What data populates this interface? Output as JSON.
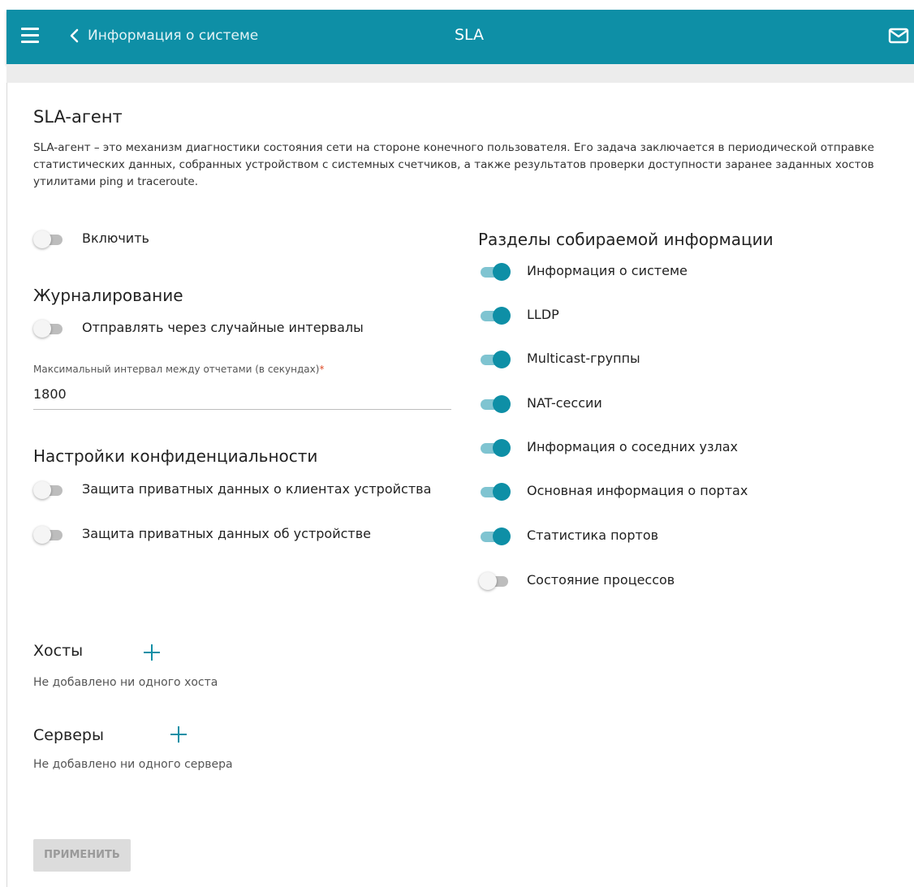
{
  "header": {
    "back_label": "Информация о системе",
    "title": "SLA",
    "accent_color": "#0e8fa6",
    "icons": [
      "menu-icon",
      "chevron-left-icon",
      "mail-icon"
    ]
  },
  "sla_agent": {
    "title": "SLA-агент",
    "description": "SLA-агент – это механизм диагностики состояния сети на стороне конечного пользователя. Его задача заключается в периодической отправке статистических данных, собранных устройством с системных счетчиков, а также результатов проверки доступности заранее заданных хостов утилитами ping и traceroute.",
    "enable": {
      "label": "Включить",
      "on": false
    }
  },
  "logging": {
    "title": "Журналирование",
    "random_intervals": {
      "label": "Отправлять через случайные интервалы",
      "on": false
    },
    "max_interval": {
      "label": "Максимальный интервал между отчетами (в секундах)",
      "required_mark": "*",
      "value": "1800"
    }
  },
  "privacy": {
    "title": "Настройки конфиденциальности",
    "toggles": [
      {
        "label": "Защита приватных данных о клиентах устройства",
        "on": false
      },
      {
        "label": "Защита приватных данных об устройстве",
        "on": false
      }
    ]
  },
  "sections": {
    "title": "Разделы собираемой информации",
    "toggles": [
      {
        "label": "Информация о системе",
        "on": true
      },
      {
        "label": "LLDP",
        "on": true
      },
      {
        "label": "Multicast-группы",
        "on": true
      },
      {
        "label": "NAT-сессии",
        "on": true
      },
      {
        "label": "Информация о соседних узлах",
        "on": true
      },
      {
        "label": "Основная информация о портах",
        "on": true
      },
      {
        "label": "Статистика портов",
        "on": true
      },
      {
        "label": "Состояние процессов",
        "on": false
      }
    ]
  },
  "hosts": {
    "title": "Хосты",
    "empty_text": "Не добавлено ни одного хоста"
  },
  "servers": {
    "title": "Серверы",
    "empty_text": "Не добавлено ни одного сервера"
  },
  "apply_label": "ПРИМЕНИТЬ"
}
